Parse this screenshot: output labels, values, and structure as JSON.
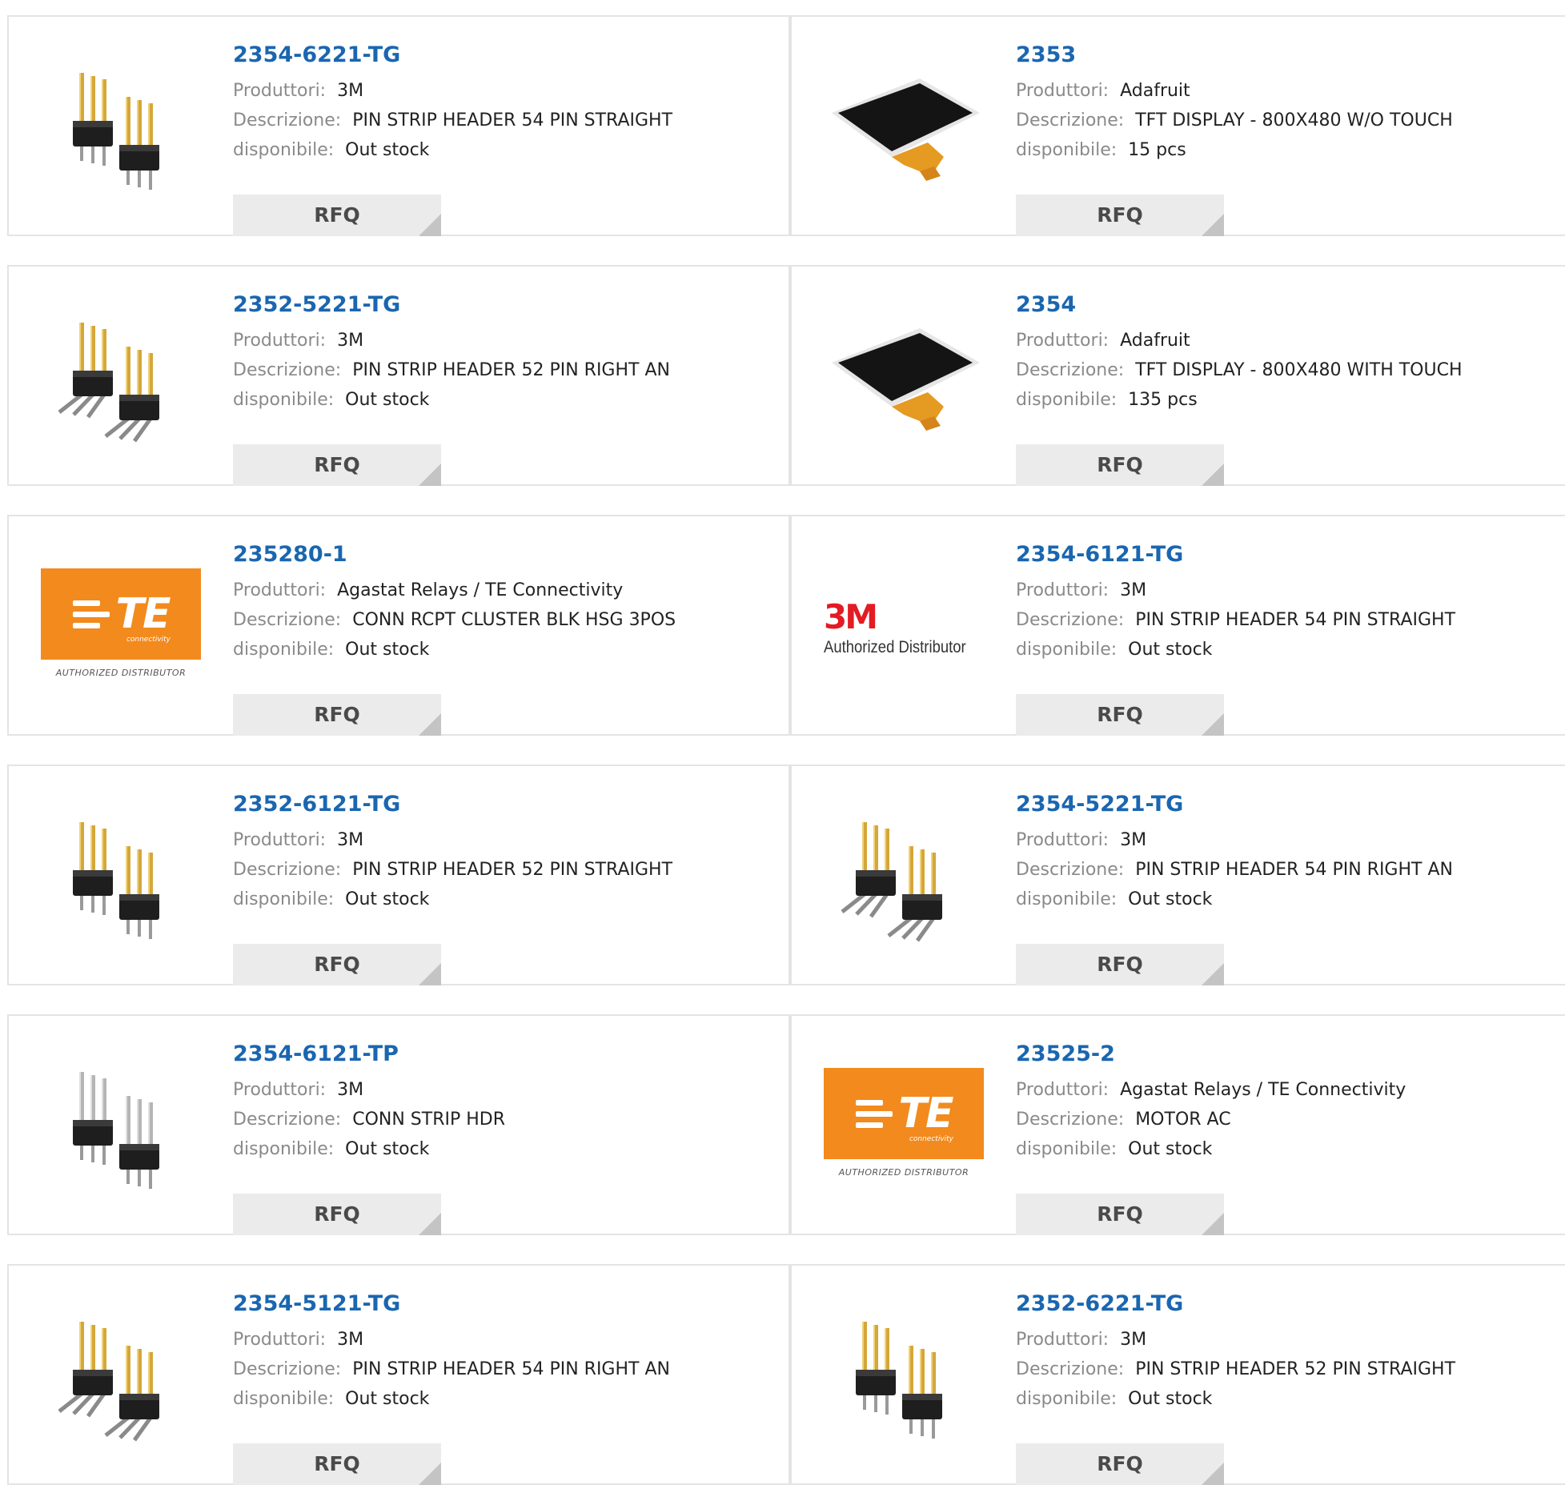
{
  "labels": {
    "manufacturer": "Produttori:",
    "description": "Descrizione:",
    "availability": "disponibile:",
    "rfq": "RFQ"
  },
  "products": [
    {
      "part": "2354-6221-TG",
      "manufacturer": "3M",
      "description": "PIN STRIP HEADER 54 PIN STRAIGHT",
      "availability": "Out stock",
      "image": "pin-header-straight"
    },
    {
      "part": "2353",
      "manufacturer": "Adafruit",
      "description": "TFT DISPLAY - 800X480 W/O TOUCH",
      "availability": "15 pcs",
      "image": "tft-display"
    },
    {
      "part": "2352-5221-TG",
      "manufacturer": "3M",
      "description": "PIN STRIP HEADER 52 PIN RIGHT AN",
      "availability": "Out stock",
      "image": "pin-header-right-angle"
    },
    {
      "part": "2354",
      "manufacturer": "Adafruit",
      "description": "TFT DISPLAY - 800X480 WITH TOUCH",
      "availability": "135 pcs",
      "image": "tft-display"
    },
    {
      "part": "235280-1",
      "manufacturer": "Agastat Relays / TE Connectivity",
      "description": "CONN RCPT CLUSTER BLK HSG 3POS",
      "availability": "Out stock",
      "image": "te-logo"
    },
    {
      "part": "2354-6121-TG",
      "manufacturer": "3M",
      "description": "PIN STRIP HEADER 54 PIN STRAIGHT",
      "availability": "Out stock",
      "image": "3m-logo"
    },
    {
      "part": "2352-6121-TG",
      "manufacturer": "3M",
      "description": "PIN STRIP HEADER 52 PIN STRAIGHT",
      "availability": "Out stock",
      "image": "pin-header-straight"
    },
    {
      "part": "2354-5221-TG",
      "manufacturer": "3M",
      "description": "PIN STRIP HEADER 54 PIN RIGHT AN",
      "availability": "Out stock",
      "image": "pin-header-right-angle"
    },
    {
      "part": "2354-6121-TP",
      "manufacturer": "3M",
      "description": "CONN STRIP HDR",
      "availability": "Out stock",
      "image": "pin-header-straight-silver"
    },
    {
      "part": "23525-2",
      "manufacturer": "Agastat Relays / TE Connectivity",
      "description": "MOTOR AC",
      "availability": "Out stock",
      "image": "te-logo"
    },
    {
      "part": "2354-5121-TG",
      "manufacturer": "3M",
      "description": "PIN STRIP HEADER 54 PIN RIGHT AN",
      "availability": "Out stock",
      "image": "pin-header-right-angle"
    },
    {
      "part": "2352-6221-TG",
      "manufacturer": "3M",
      "description": "PIN STRIP HEADER 52 PIN STRAIGHT",
      "availability": "Out stock",
      "image": "pin-header-straight"
    }
  ],
  "logos": {
    "te_text": "TE",
    "te_sub": "connectivity",
    "te_tagline": "AUTHORIZED DISTRIBUTOR",
    "m3_text": "3M",
    "m3_tagline": "Authorized Distributor"
  },
  "colors": {
    "part_link": "#1a66b0",
    "label": "#8a8a8a",
    "rfq_bg": "#ebebeb",
    "te_orange": "#f28a1e",
    "m3_red": "#e31b23"
  }
}
